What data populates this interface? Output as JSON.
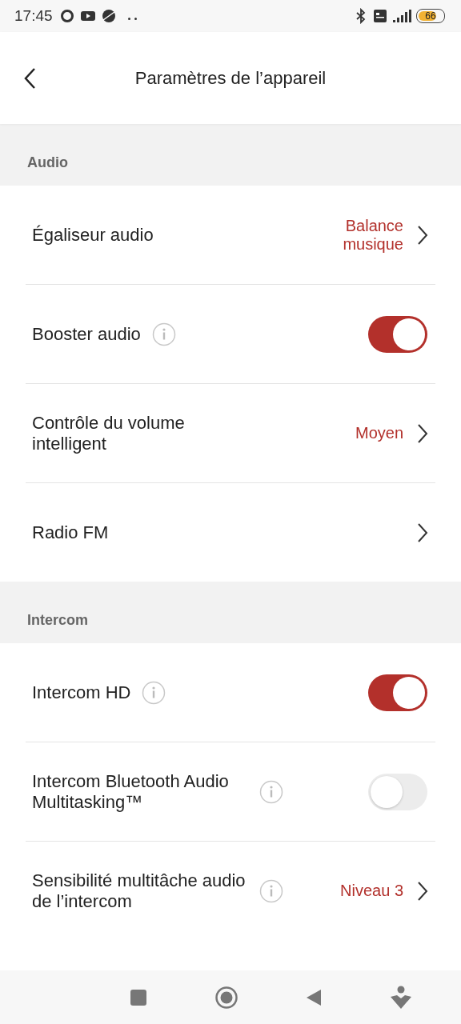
{
  "status_bar": {
    "time": "17:45",
    "battery": "66"
  },
  "header": {
    "title": "Paramètres de l’appareil"
  },
  "sections": [
    {
      "title": "Audio",
      "rows": [
        {
          "kind": "link",
          "label": "Égaliseur audio",
          "value": "Balance musique"
        },
        {
          "kind": "toggle",
          "label": "Booster audio",
          "info": true,
          "on": true
        },
        {
          "kind": "link",
          "label": "Contrôle du volume intelligent",
          "value": "Moyen"
        },
        {
          "kind": "link",
          "label": "Radio FM"
        }
      ]
    },
    {
      "title": "Intercom",
      "rows": [
        {
          "kind": "toggle",
          "label": "Intercom HD",
          "info": true,
          "on": true
        },
        {
          "kind": "toggle",
          "label": "Intercom Bluetooth Audio Multitasking™",
          "info": true,
          "on": false
        },
        {
          "kind": "link",
          "label": "Sensibilité multitâche audio de l’intercom",
          "info": true,
          "value": "Niveau 3"
        }
      ]
    }
  ]
}
